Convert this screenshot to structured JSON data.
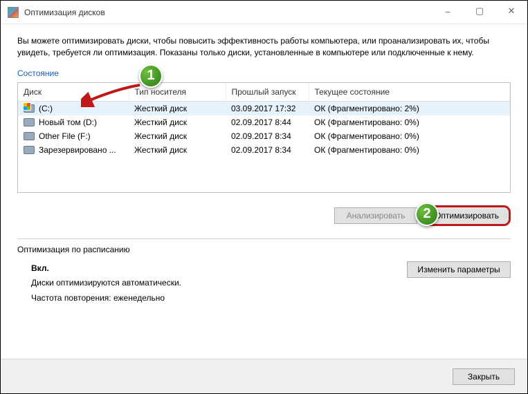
{
  "window": {
    "title": "Оптимизация дисков"
  },
  "description": "Вы можете оптимизировать диски, чтобы повысить эффективность работы  компьютера, или проанализировать их, чтобы увидеть, требуется ли оптимизация. Показаны только диски, установленные в компьютере или подключенные к нему.",
  "status_label": "Состояние",
  "columns": {
    "disk": "Диск",
    "media": "Тип носителя",
    "last_run": "Прошлый запуск",
    "current": "Текущее состояние"
  },
  "rows": [
    {
      "name": "(C:)",
      "media": "Жесткий диск",
      "last": "03.09.2017 17:32",
      "state": "ОК (Фрагментировано: 2%)",
      "os": true,
      "selected": true
    },
    {
      "name": "Новый том (D:)",
      "media": "Жесткий диск",
      "last": "02.09.2017 8:44",
      "state": "ОК (Фрагментировано: 0%)",
      "os": false,
      "selected": false
    },
    {
      "name": "Other File (F:)",
      "media": "Жесткий диск",
      "last": "02.09.2017 8:34",
      "state": "ОК (Фрагментировано: 0%)",
      "os": false,
      "selected": false
    },
    {
      "name": "Зарезервировано ...",
      "media": "Жесткий диск",
      "last": "02.09.2017 8:34",
      "state": "ОК (Фрагментировано: 0%)",
      "os": false,
      "selected": false
    }
  ],
  "buttons": {
    "analyze": "Анализировать",
    "optimize": "Оптимизировать",
    "change": "Изменить параметры",
    "close": "Закрыть"
  },
  "schedule": {
    "label": "Оптимизация по расписанию",
    "on": "Вкл.",
    "auto": "Диски оптимизируются автоматически.",
    "freq": "Частота повторения: еженедельно"
  },
  "callouts": {
    "one": "1",
    "two": "2"
  }
}
